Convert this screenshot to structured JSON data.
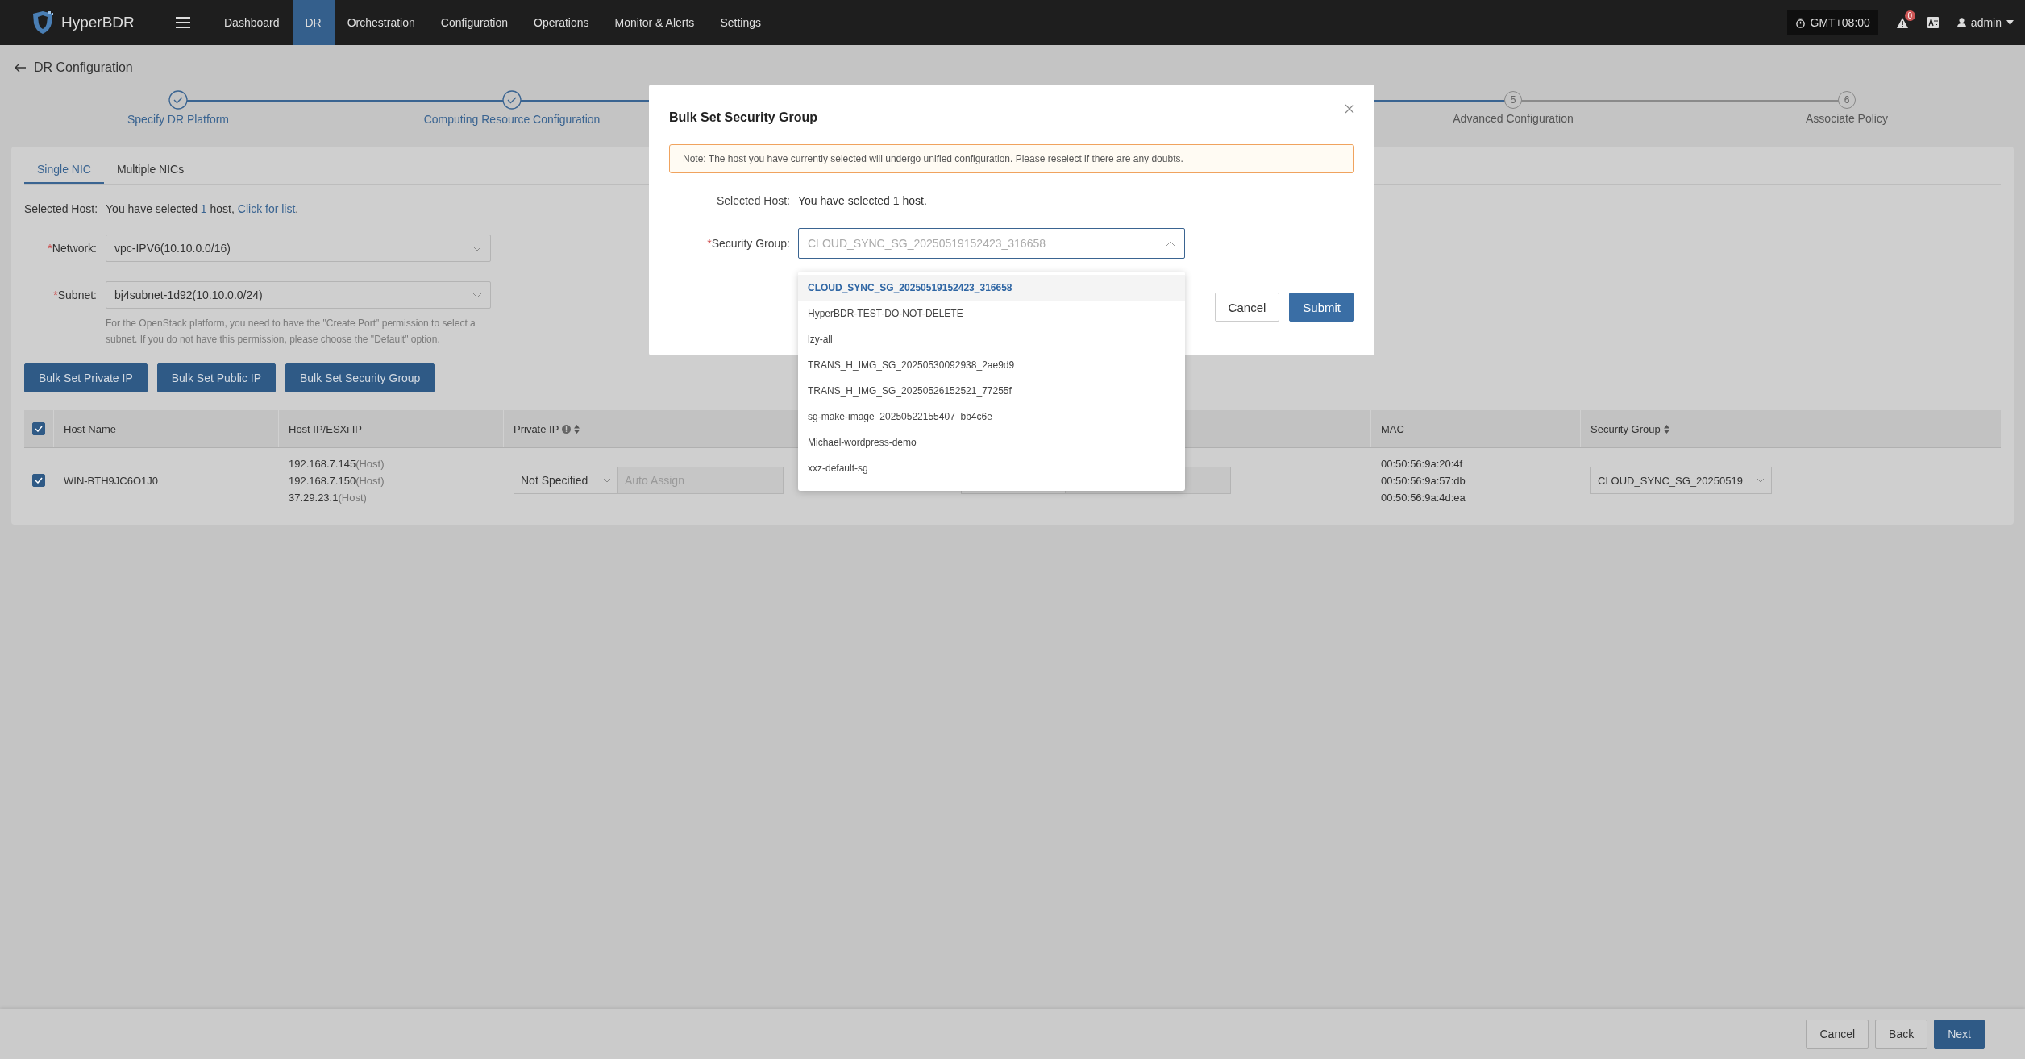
{
  "topbar": {
    "brand": "HyperBDR",
    "nav": [
      {
        "label": "Dashboard",
        "selected": false
      },
      {
        "label": "DR",
        "selected": true
      },
      {
        "label": "Orchestration",
        "selected": false
      },
      {
        "label": "Configuration",
        "selected": false
      },
      {
        "label": "Operations",
        "selected": false
      },
      {
        "label": "Monitor & Alerts",
        "selected": false
      },
      {
        "label": "Settings",
        "selected": false
      }
    ],
    "timezone": "GMT+08:00",
    "alert_count": "0",
    "user": "admin"
  },
  "page": {
    "title": "DR Configuration"
  },
  "steps": [
    {
      "label": "Specify DR Platform",
      "done": true
    },
    {
      "label": "Computing Resource Configuration",
      "done": true
    },
    {
      "number": "5",
      "label": "Advanced Configuration",
      "done": false
    },
    {
      "number": "6",
      "label": "Associate Policy",
      "done": false
    }
  ],
  "nic_tabs": [
    {
      "label": "Single NIC",
      "selected": true
    },
    {
      "label": "Multiple NICs",
      "selected": false
    }
  ],
  "selected_host": {
    "label": "Selected Host:",
    "before": "You have selected ",
    "count": "1",
    "after": " host, ",
    "link": "Click for list",
    "end": "."
  },
  "network": {
    "label": "Network:",
    "required_mark": "*",
    "value": "vpc-IPV6(10.10.0.0/16)"
  },
  "subnet": {
    "label": "Subnet:",
    "required_mark": "*",
    "value": "bj4subnet-1d92(10.10.0.0/24)",
    "help": "For the OpenStack platform, you need to have the \"Create Port\" permission to select a subnet. If you do not have this permission, please choose the \"Default\" option."
  },
  "bulk_buttons": [
    "Bulk Set Private IP",
    "Bulk Set Public IP",
    "Bulk Set Security Group"
  ],
  "table": {
    "select_all": true,
    "columns": [
      {
        "label": "Host Name",
        "info": false,
        "sortable": false
      },
      {
        "label": "Host IP/ESXi IP",
        "info": false,
        "sortable": false
      },
      {
        "label": "Private IP",
        "info": true,
        "sortable": true
      },
      {
        "label": "MAC",
        "info": false,
        "sortable": false
      },
      {
        "label": "Security Group",
        "info": false,
        "sortable": true
      }
    ],
    "rows": [
      {
        "checked": true,
        "host_name": "WIN-BTH9JC6O1J0",
        "host_ips": [
          {
            "ip": "192.168.7.145",
            "tag": "(Host)"
          },
          {
            "ip": "192.168.7.150",
            "tag": "(Host)"
          },
          {
            "ip": "37.29.23.1",
            "tag": "(Host)"
          }
        ],
        "private_ip": {
          "mode": "Not Specified",
          "placeholder": "Auto Assign"
        },
        "macs": [
          "00:50:56:9a:20:4f",
          "00:50:56:9a:57:db",
          "00:50:56:9a:4d:ea"
        ],
        "security_group": "CLOUD_SYNC_SG_20250519"
      }
    ]
  },
  "footer_buttons": [
    {
      "label": "Cancel",
      "kind": "default"
    },
    {
      "label": "Back",
      "kind": "default"
    },
    {
      "label": "Next",
      "kind": "primary"
    }
  ],
  "modal": {
    "title": "Bulk Set Security Group",
    "note": "Note: The host you have currently selected will undergo unified configuration. Please reselect if there are any doubts.",
    "selected_host": {
      "label": "Selected Host:",
      "text": "You have selected 1 host."
    },
    "security_group": {
      "label": "Security Group:",
      "required_mark": "*",
      "placeholder": "CLOUD_SYNC_SG_20250519152423_316658",
      "open": true
    },
    "options": [
      {
        "label": "CLOUD_SYNC_SG_20250519152423_316658",
        "selected": true
      },
      {
        "label": "HyperBDR-TEST-DO-NOT-DELETE",
        "selected": false
      },
      {
        "label": "lzy-all",
        "selected": false
      },
      {
        "label": "TRANS_H_IMG_SG_20250530092938_2ae9d9",
        "selected": false
      },
      {
        "label": "TRANS_H_IMG_SG_20250526152521_77255f",
        "selected": false
      },
      {
        "label": "sg-make-image_20250522155407_bb4c6e",
        "selected": false
      },
      {
        "label": "Michael-wordpress-demo",
        "selected": false
      },
      {
        "label": "xxz-default-sg",
        "selected": false
      }
    ],
    "buttons": [
      {
        "label": "Cancel",
        "kind": "default"
      },
      {
        "label": "Submit",
        "kind": "primary"
      }
    ]
  }
}
